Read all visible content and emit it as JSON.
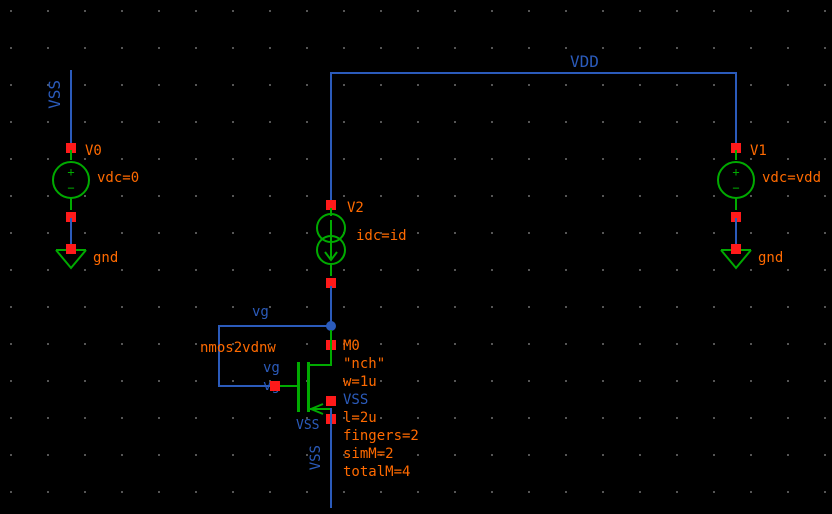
{
  "nets": {
    "vss": "VSS",
    "vdd": "VDD",
    "vg": "vg",
    "gnd": "gnd"
  },
  "v0": {
    "name": "V0",
    "param": "vdc=0"
  },
  "v1": {
    "name": "V1",
    "param": "vdc=vdd"
  },
  "i2": {
    "name": "V2",
    "param": "idc=id"
  },
  "mos": {
    "cell": "nmos2vdnw",
    "name": "M0",
    "model": "\"nch\"",
    "w": "w=1u",
    "l": "l=2u",
    "fingers": "fingers=2",
    "simM": "simM=2",
    "totalM": "totalM=4",
    "gate_net": "vg",
    "bulk_net": "VSS",
    "source_net": "VSS"
  }
}
